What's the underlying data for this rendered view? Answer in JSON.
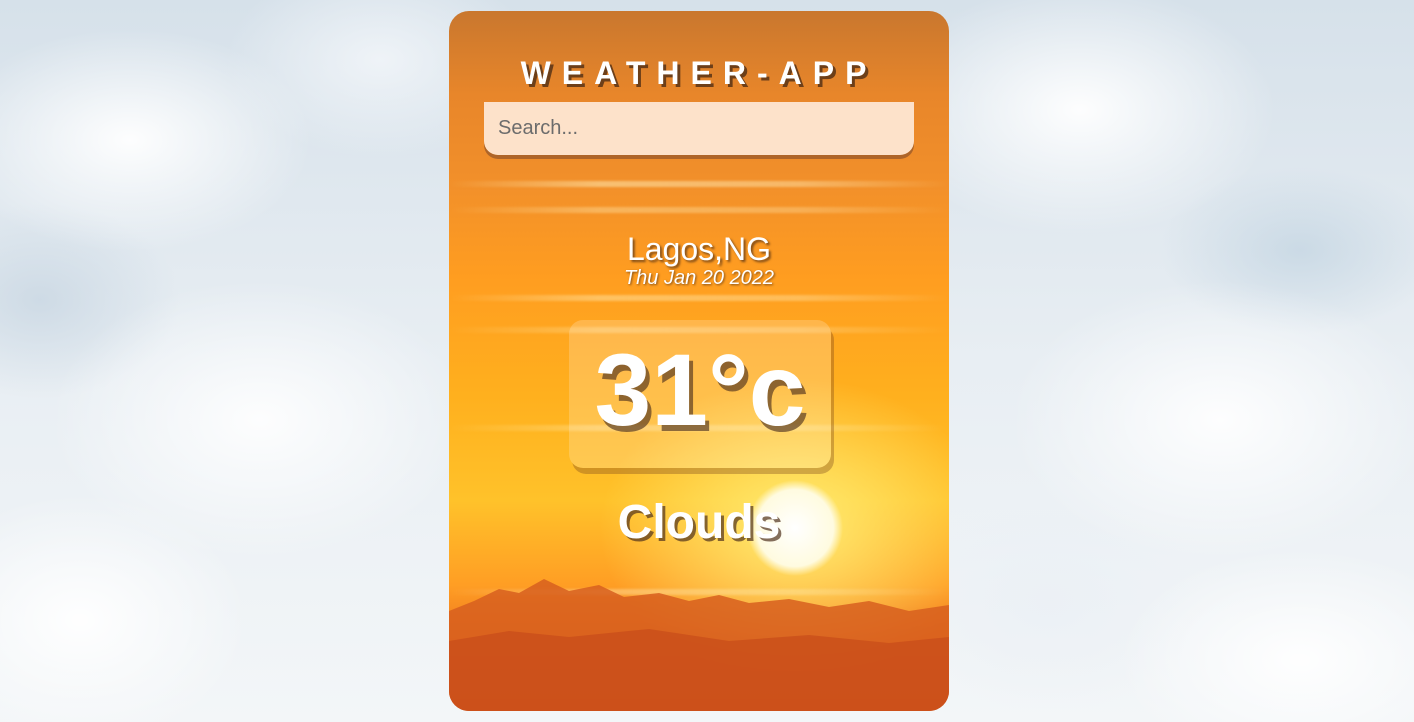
{
  "app": {
    "title": "WEATHER-APP"
  },
  "search": {
    "placeholder": "Search...",
    "value": ""
  },
  "weather": {
    "location": "Lagos,NG",
    "date": "Thu Jan 20 2022",
    "temperature": "31°c",
    "condition": "Clouds"
  },
  "colors": {
    "text": "#ffffff",
    "card_top": "#c9772e",
    "card_mid": "#ffb01e",
    "card_bottom": "#c8501a",
    "search_bg": "#ffeee0"
  }
}
